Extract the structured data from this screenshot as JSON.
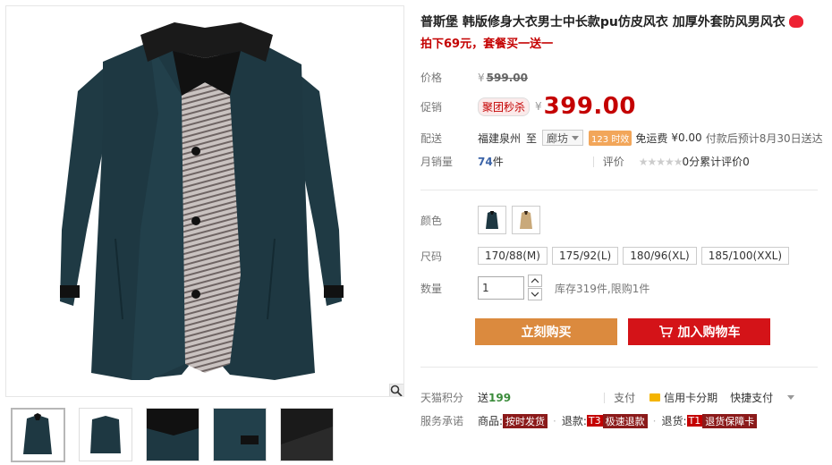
{
  "product": {
    "title": "普斯堡 韩版修身大衣男士中长款pu仿皮风衣 加厚外套防风男风衣",
    "subtitle": "拍下69元，套餐买一送一"
  },
  "price": {
    "label": "价格",
    "currency": "¥",
    "original": "599.00"
  },
  "promo": {
    "label": "促销",
    "tag": "聚团秒杀",
    "currency": "¥",
    "price": "399.00"
  },
  "shipping": {
    "label": "配送",
    "from": "福建泉州",
    "to_word": "至",
    "destination": "廊坊",
    "timely_tag": "123 时效",
    "fee_text": "免运费",
    "fee": "¥0.00",
    "eta": "付款后预计8月30日送达"
  },
  "sales": {
    "label": "月销量",
    "count": "74",
    "unit": "件",
    "rating_label": "评价",
    "stars": "★★★★★",
    "score": "0分",
    "reviews": "累计评价0"
  },
  "options": {
    "color_label": "颜色",
    "size_label": "尺码",
    "sizes": [
      "170/88(M)",
      "175/92(L)",
      "180/96(XL)",
      "185/100(XXL)"
    ],
    "qty_label": "数量",
    "qty_value": "1",
    "stock": "库存319件,限购1件"
  },
  "actions": {
    "buy_now": "立刻购买",
    "add_cart": "加入购物车"
  },
  "footer": {
    "points_label": "天猫积分",
    "points_prefix": "送",
    "points_value": "199",
    "pay_label": "支付",
    "credit_card": "信用卡分期",
    "quick_pay": "快捷支付",
    "service_label": "服务承诺",
    "goods_label": "商品:",
    "goods_tag": "按时发货",
    "refund_label": "退款:",
    "refund_tag_code": "T3",
    "refund_tag": "极速退款",
    "return_label": "退货:",
    "return_tag_code": "T1",
    "return_tag": "退货保障卡"
  },
  "colors": {
    "price_red": "#c40000",
    "buy_orange": "#db8a3e",
    "cart_red": "#d41318",
    "coat_teal": "#1f3a44"
  }
}
